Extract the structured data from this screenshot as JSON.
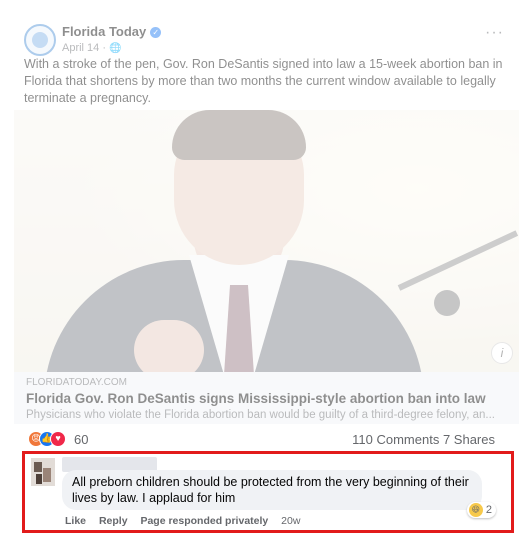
{
  "post": {
    "page_name": "Florida Today",
    "date": "April 14 ·",
    "text": "With a stroke of the pen, Gov. Ron DeSantis signed into law a 15-week abortion ban in Florida that shortens by more than two months the current window available to legally terminate a pregnancy.",
    "more_label": "···"
  },
  "link_preview": {
    "domain": "FLORIDATODAY.COM",
    "title": "Florida Gov. Ron DeSantis signs Mississippi-style abortion ban into law",
    "description": "Physicians who violate the Florida abortion ban would be guilty of a third-degree felony, an..."
  },
  "stats": {
    "reaction_count": "60",
    "comments": "110 Comments",
    "shares": "7 Shares"
  },
  "comment": {
    "text": "All preborn children should be protected from the very beginning of their lives by law. I applaud for him",
    "reaction_count": "2",
    "actions": {
      "like": "Like",
      "reply": "Reply",
      "page_note": "Page responded privately",
      "time": "20w"
    }
  },
  "colors": {
    "highlight_border": "#e21b1b",
    "brand_blue": "#1877f2"
  }
}
